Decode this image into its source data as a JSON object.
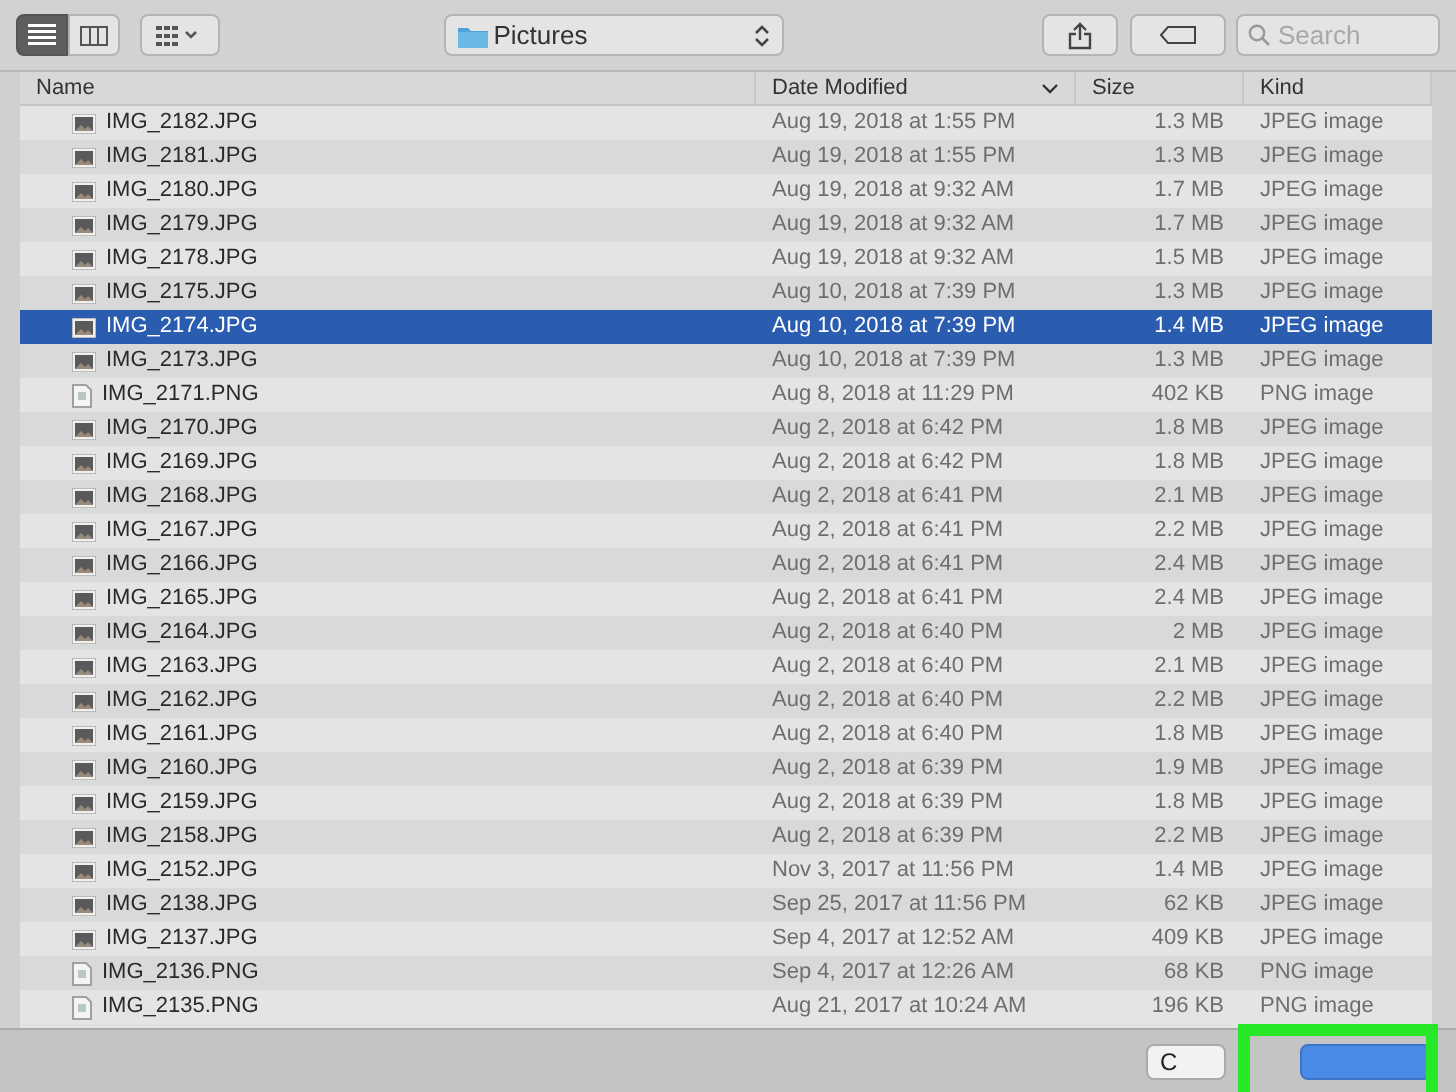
{
  "toolbar": {
    "views": [
      {
        "kind": "list",
        "selected": true
      },
      {
        "kind": "columns",
        "selected": false
      },
      {
        "kind": "grid",
        "selected": false
      }
    ],
    "location": "Pictures",
    "search": {
      "placeholder": "Search"
    }
  },
  "table": {
    "columns": [
      {
        "label": "Name",
        "sorted": false
      },
      {
        "label": "Date Modified",
        "sorted": true
      },
      {
        "label": "Size",
        "sorted": false
      },
      {
        "label": "Kind",
        "sorted": false
      }
    ],
    "rows": [
      {
        "name": "IMG_2182.JPG",
        "date": "Aug 19, 2018 at 1:55 PM",
        "size": "1.3 MB",
        "file_type": "JPEG image",
        "kind": "photo",
        "selected": false
      },
      {
        "name": "IMG_2181.JPG",
        "date": "Aug 19, 2018 at 1:55 PM",
        "size": "1.3 MB",
        "file_type": "JPEG image",
        "kind": "photo",
        "selected": false
      },
      {
        "name": "IMG_2180.JPG",
        "date": "Aug 19, 2018 at 9:32 AM",
        "size": "1.7 MB",
        "file_type": "JPEG image",
        "kind": "photo",
        "selected": false
      },
      {
        "name": "IMG_2179.JPG",
        "date": "Aug 19, 2018 at 9:32 AM",
        "size": "1.7 MB",
        "file_type": "JPEG image",
        "kind": "photo",
        "selected": false
      },
      {
        "name": "IMG_2178.JPG",
        "date": "Aug 19, 2018 at 9:32 AM",
        "size": "1.5 MB",
        "file_type": "JPEG image",
        "kind": "photo",
        "selected": false
      },
      {
        "name": "IMG_2175.JPG",
        "date": "Aug 10, 2018 at 7:39 PM",
        "size": "1.3 MB",
        "file_type": "JPEG image",
        "kind": "photo",
        "selected": false
      },
      {
        "name": "IMG_2174.JPG",
        "date": "Aug 10, 2018 at 7:39 PM",
        "size": "1.4 MB",
        "file_type": "JPEG image",
        "kind": "photo",
        "selected": true
      },
      {
        "name": "IMG_2173.JPG",
        "date": "Aug 10, 2018 at 7:39 PM",
        "size": "1.3 MB",
        "file_type": "JPEG image",
        "kind": "photo",
        "selected": false
      },
      {
        "name": "IMG_2171.PNG",
        "date": "Aug 8, 2018 at 11:29 PM",
        "size": "402 KB",
        "file_type": "PNG image",
        "kind": "document",
        "selected": false
      },
      {
        "name": "IMG_2170.JPG",
        "date": "Aug 2, 2018 at 6:42 PM",
        "size": "1.8 MB",
        "file_type": "JPEG image",
        "kind": "photo",
        "selected": false
      },
      {
        "name": "IMG_2169.JPG",
        "date": "Aug 2, 2018 at 6:42 PM",
        "size": "1.8 MB",
        "file_type": "JPEG image",
        "kind": "photo",
        "selected": false
      },
      {
        "name": "IMG_2168.JPG",
        "date": "Aug 2, 2018 at 6:41 PM",
        "size": "2.1 MB",
        "file_type": "JPEG image",
        "kind": "photo",
        "selected": false
      },
      {
        "name": "IMG_2167.JPG",
        "date": "Aug 2, 2018 at 6:41 PM",
        "size": "2.2 MB",
        "file_type": "JPEG image",
        "kind": "photo",
        "selected": false
      },
      {
        "name": "IMG_2166.JPG",
        "date": "Aug 2, 2018 at 6:41 PM",
        "size": "2.4 MB",
        "file_type": "JPEG image",
        "kind": "photo",
        "selected": false
      },
      {
        "name": "IMG_2165.JPG",
        "date": "Aug 2, 2018 at 6:41 PM",
        "size": "2.4 MB",
        "file_type": "JPEG image",
        "kind": "photo",
        "selected": false
      },
      {
        "name": "IMG_2164.JPG",
        "date": "Aug 2, 2018 at 6:40 PM",
        "size": "2 MB",
        "file_type": "JPEG image",
        "kind": "photo",
        "selected": false
      },
      {
        "name": "IMG_2163.JPG",
        "date": "Aug 2, 2018 at 6:40 PM",
        "size": "2.1 MB",
        "file_type": "JPEG image",
        "kind": "photo",
        "selected": false
      },
      {
        "name": "IMG_2162.JPG",
        "date": "Aug 2, 2018 at 6:40 PM",
        "size": "2.2 MB",
        "file_type": "JPEG image",
        "kind": "photo",
        "selected": false
      },
      {
        "name": "IMG_2161.JPG",
        "date": "Aug 2, 2018 at 6:40 PM",
        "size": "1.8 MB",
        "file_type": "JPEG image",
        "kind": "photo",
        "selected": false
      },
      {
        "name": "IMG_2160.JPG",
        "date": "Aug 2, 2018 at 6:39 PM",
        "size": "1.9 MB",
        "file_type": "JPEG image",
        "kind": "photo",
        "selected": false
      },
      {
        "name": "IMG_2159.JPG",
        "date": "Aug 2, 2018 at 6:39 PM",
        "size": "1.8 MB",
        "file_type": "JPEG image",
        "kind": "photo",
        "selected": false
      },
      {
        "name": "IMG_2158.JPG",
        "date": "Aug 2, 2018 at 6:39 PM",
        "size": "2.2 MB",
        "file_type": "JPEG image",
        "kind": "photo",
        "selected": false
      },
      {
        "name": "IMG_2152.JPG",
        "date": "Nov 3, 2017 at 11:56 PM",
        "size": "1.4 MB",
        "file_type": "JPEG image",
        "kind": "photo",
        "selected": false
      },
      {
        "name": "IMG_2138.JPG",
        "date": "Sep 25, 2017 at 11:56 PM",
        "size": "62 KB",
        "file_type": "JPEG image",
        "kind": "photo",
        "selected": false
      },
      {
        "name": "IMG_2137.JPG",
        "date": "Sep 4, 2017 at 12:52 AM",
        "size": "409 KB",
        "file_type": "JPEG image",
        "kind": "photo",
        "selected": false
      },
      {
        "name": "IMG_2136.PNG",
        "date": "Sep 4, 2017 at 12:26 AM",
        "size": "68 KB",
        "file_type": "PNG image",
        "kind": "document",
        "selected": false
      },
      {
        "name": "IMG_2135.PNG",
        "date": "Aug 21, 2017 at 10:24 AM",
        "size": "196 KB",
        "file_type": "PNG image",
        "kind": "document",
        "selected": false
      }
    ]
  },
  "buttons": [
    {
      "label": "C",
      "kind": "secondary"
    },
    {
      "kind": "primary"
    }
  ]
}
